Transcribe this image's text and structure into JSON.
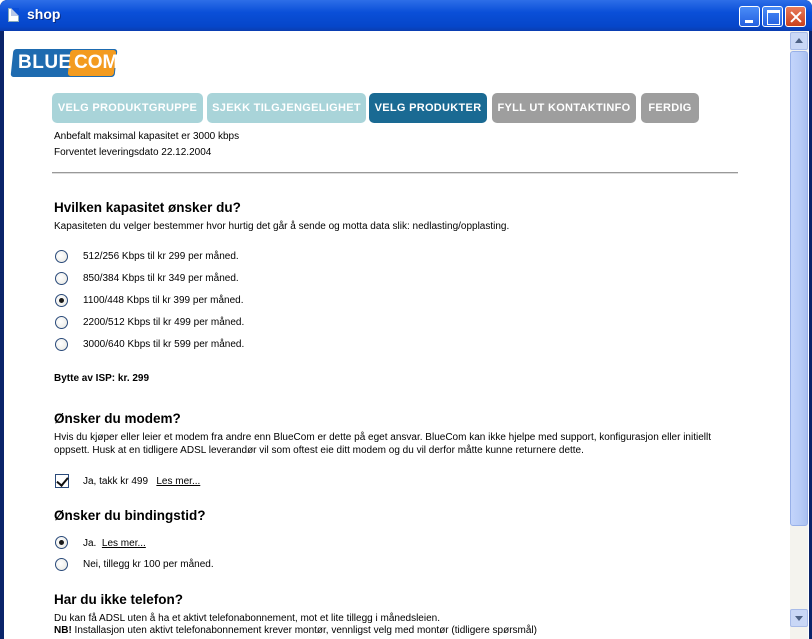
{
  "window": {
    "title": "shop"
  },
  "logo": {
    "blue": "BLUE",
    "com": "COM"
  },
  "steps": [
    {
      "label": "VELG PRODUKTGRUPPE",
      "state": "done"
    },
    {
      "label": "SJEKK TILGJENGELIGHET",
      "state": "done"
    },
    {
      "label": "VELG PRODUKTER",
      "state": "active"
    },
    {
      "label": "FYLL UT KONTAKTINFO",
      "state": "todo"
    },
    {
      "label": "FERDIG",
      "state": "todo"
    }
  ],
  "info": {
    "capacity": "Anbefalt maksimal kapasitet er 3000 kbps",
    "delivery": "Forventet leveringsdato 22.12.2004"
  },
  "capacity": {
    "heading": "Hvilken kapasitet ønsker du?",
    "description": "Kapasiteten du velger bestemmer hvor hurtig det går å sende og motta data slik: nedlasting/opplasting.",
    "options": [
      {
        "label": "512/256 Kbps til kr 299 per måned.",
        "checked": false
      },
      {
        "label": "850/384 Kbps til kr 349 per måned.",
        "checked": false
      },
      {
        "label": "1100/448 Kbps til kr 399 per måned.",
        "checked": true
      },
      {
        "label": "2200/512 Kbps til kr 499 per måned.",
        "checked": false
      },
      {
        "label": "3000/640 Kbps til kr 599 per måned.",
        "checked": false
      }
    ],
    "isp_fee": "Bytte av ISP: kr. 299"
  },
  "modem": {
    "heading": "Ønsker du modem?",
    "description": "Hvis du kjøper eller leier et modem fra andre enn BlueCom er dette på eget ansvar. BlueCom kan ikke hjelpe med support, konfigurasjon eller initiellt oppsett. Husk at en tidligere ADSL leverandør vil som oftest eie ditt modem og du vil derfor måtte kunne returnere dette.",
    "option_label": "Ja, takk kr 499",
    "read_more": "Les mer...",
    "checked": true
  },
  "binding": {
    "heading": "Ønsker du bindingstid?",
    "yes_label": "Ja.",
    "read_more": "Les mer...",
    "no_label": "Nei, tillegg kr 100 per måned."
  },
  "phone": {
    "heading": "Har du ikke telefon?",
    "line1": "Du kan få ADSL uten å ha et aktivt telefonabonnement, mot et lite tillegg i månedsleien.",
    "nb_label": "NB!",
    "line2": " Installasjon uten aktivt telefonabonnement krever montør, vennligst velg med montør (tidligere spørsmål)"
  }
}
